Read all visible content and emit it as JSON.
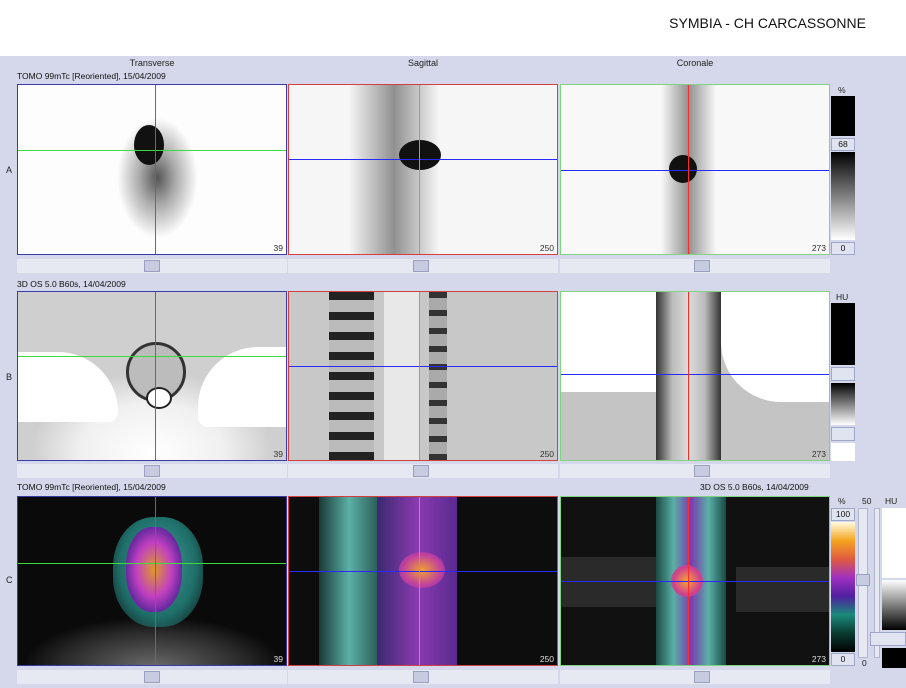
{
  "header": {
    "title": "SYMBIA - CH CARCASSONNE"
  },
  "columns": [
    "Transverse",
    "Sagittal",
    "Coronale"
  ],
  "rows": [
    {
      "letter": "A",
      "info": "TOMO 99mTc [Reoriented], 15/04/2009",
      "slice_numbers": [
        "39",
        "250",
        "273"
      ]
    },
    {
      "letter": "B",
      "info": "3D  OS  5.0  B60s, 14/04/2009",
      "slice_numbers": [
        "39",
        "250",
        "273"
      ]
    },
    {
      "letter": "C",
      "info_left": "TOMO 99mTc [Reoriented], 15/04/2009",
      "info_right": "3D  OS  5.0  B60s, 14/04/2009",
      "slice_numbers": [
        "39",
        "250",
        "273"
      ]
    }
  ],
  "scales": {
    "a": {
      "unit": "%",
      "max": "68",
      "min": "0"
    },
    "b": {
      "unit": "HU"
    },
    "c": {
      "unit_pct": "%",
      "mid": "50",
      "unit_hu": "HU",
      "max": "100",
      "min": "0",
      "bottom": "0"
    }
  },
  "colors": {
    "crosshair_red": "#ff2a2a",
    "crosshair_green": "#3bdc3b",
    "crosshair_blue": "#2a2aff",
    "border_transverse": "#3a3aa8",
    "border_sagittal": "#d44040",
    "border_coronale": "#7fd47f",
    "panel_bg": "#d4d8ea"
  }
}
